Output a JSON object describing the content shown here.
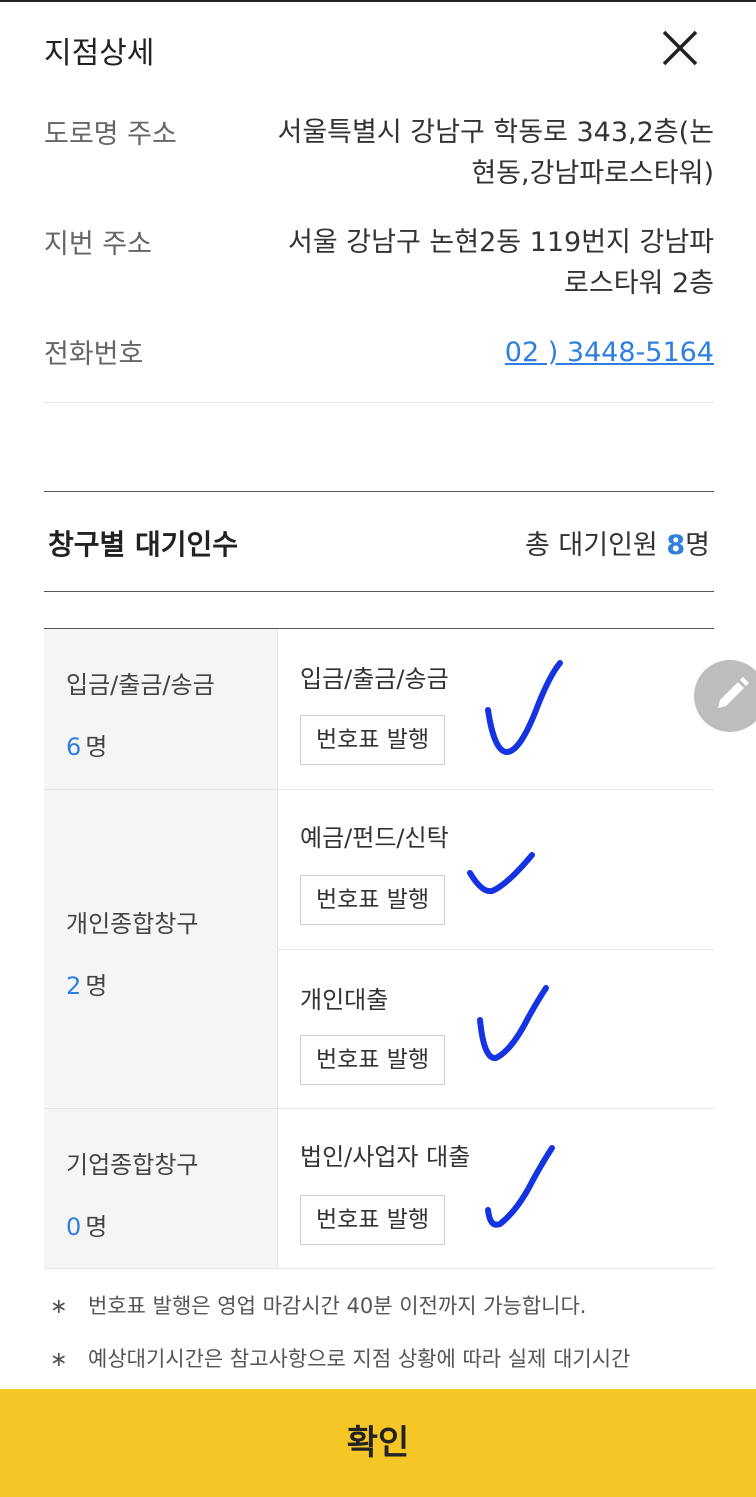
{
  "header": {
    "title": "지점상세",
    "close_icon": "close-icon"
  },
  "info": {
    "road_address": {
      "label": "도로명 주소",
      "line1": "서울특별시 강남구 학동로 343,2층(논",
      "line2": "현동,강남파로스타워)"
    },
    "lot_address": {
      "label": "지번 주소",
      "line1": "서울 강남구 논현2동 119번지 강남파",
      "line2": "로스타워 2층"
    },
    "phone": {
      "label": "전화번호",
      "value": "02 ) 3448-5164"
    }
  },
  "wait": {
    "title": "창구별 대기인수",
    "total_prefix": "총 대기인원",
    "total_count": "8",
    "total_unit": "명"
  },
  "groups": [
    {
      "name": "입금/출금/송금",
      "count": "6",
      "unit": "명",
      "services": [
        {
          "name": "입금/출금/송금",
          "button": "번호표 발행"
        }
      ]
    },
    {
      "name": "개인종합창구",
      "count": "2",
      "unit": "명",
      "services": [
        {
          "name": "예금/펀드/신탁",
          "button": "번호표 발행"
        },
        {
          "name": "개인대출",
          "button": "번호표 발행"
        }
      ]
    },
    {
      "name": "기업종합창구",
      "count": "0",
      "unit": "명",
      "services": [
        {
          "name": "법인/사업자 대출",
          "button": "번호표 발행"
        }
      ]
    }
  ],
  "notes": [
    {
      "star": "∗",
      "text": "번호표 발행은 영업 마감시간 40분 이전까지 가능합니다."
    },
    {
      "star": "∗",
      "text": "예상대기시간은 참고사항으로 지점 상황에 따라 실제 대기시간"
    }
  ],
  "confirm_label": "확인",
  "edit_icon": "pencil-icon",
  "colors": {
    "accent_blue": "#2f7fe0",
    "confirm_yellow": "#f6c526",
    "check_blue": "#1533e0"
  }
}
